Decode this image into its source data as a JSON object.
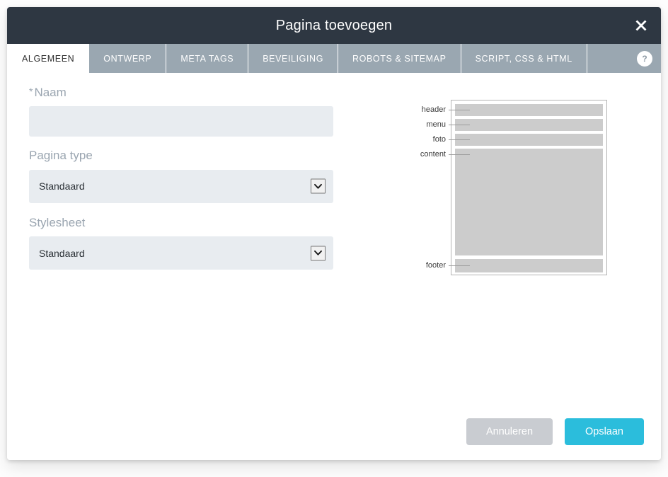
{
  "dialog": {
    "title": "Pagina toevoegen",
    "close_label": "Sluiten",
    "help_label": "?"
  },
  "tabs": [
    {
      "id": "algemeen",
      "label": "ALGEMEEN",
      "active": true
    },
    {
      "id": "ontwerp",
      "label": "ONTWERP",
      "active": false
    },
    {
      "id": "meta-tags",
      "label": "META TAGS",
      "active": false
    },
    {
      "id": "beveiliging",
      "label": "BEVEILIGING",
      "active": false
    },
    {
      "id": "robots",
      "label": "ROBOTS & SITEMAP",
      "active": false
    },
    {
      "id": "script",
      "label": "SCRIPT, CSS & HTML",
      "active": false
    }
  ],
  "form": {
    "naam": {
      "label": "Naam",
      "required_marker": "*",
      "value": "",
      "placeholder": ""
    },
    "pagina_type": {
      "label": "Pagina type",
      "value": "Standaard",
      "options": [
        "Standaard"
      ]
    },
    "stylesheet": {
      "label": "Stylesheet",
      "value": "Standaard",
      "options": [
        "Standaard"
      ]
    }
  },
  "preview": {
    "regions": [
      {
        "id": "header",
        "label": "header"
      },
      {
        "id": "menu",
        "label": "menu"
      },
      {
        "id": "foto",
        "label": "foto"
      },
      {
        "id": "content",
        "label": "content"
      },
      {
        "id": "footer",
        "label": "footer"
      }
    ]
  },
  "actions": {
    "cancel_label": "Annuleren",
    "save_label": "Opslaan"
  },
  "colors": {
    "titlebar": "#2e3742",
    "tabbar": "#9aa7b1",
    "field_bg": "#e8ecf0",
    "label": "#9aa5b0",
    "save_accent": "#2bbddc",
    "cancel_grey": "#c9ccd1",
    "preview_block": "#cccccc"
  }
}
